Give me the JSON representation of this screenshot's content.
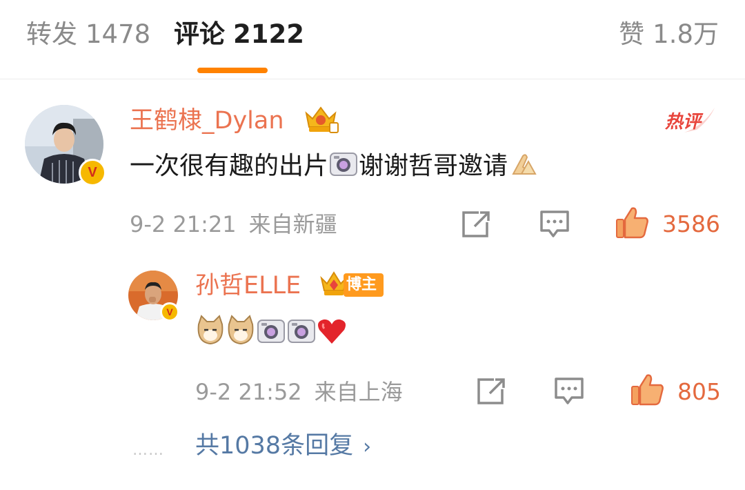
{
  "tabs": {
    "repost": {
      "label": "转发",
      "count": "1478"
    },
    "comments": {
      "label": "评论",
      "count": "2122"
    },
    "likes": {
      "label": "赞",
      "count": "1.8万"
    }
  },
  "comment": {
    "username": "王鹤棣_Dylan",
    "hot_tag": "热评",
    "text_a": "一次很有趣的出片",
    "text_b": "谢谢哲哥邀请",
    "emojis": [
      "camera-emoji",
      "pray-emoji"
    ],
    "time": "9-2 21:21",
    "source": "来自新疆",
    "likes": "3586",
    "verified_badge": "V"
  },
  "reply": {
    "username": "孙哲ELLE",
    "badge": "博主",
    "emojis": [
      "cat-emoji",
      "cat-emoji",
      "camera-emoji",
      "camera-emoji",
      "heart-emoji"
    ],
    "time": "9-2 21:52",
    "source": "来自上海",
    "likes": "805",
    "verified_badge": "V"
  },
  "more_replies": {
    "dots": "……",
    "label": "共1038条回复",
    "chevron": "›"
  },
  "colors": {
    "accent": "#ff8200",
    "username": "#eb7350",
    "link": "#5579a4",
    "like": "#e4693e"
  }
}
